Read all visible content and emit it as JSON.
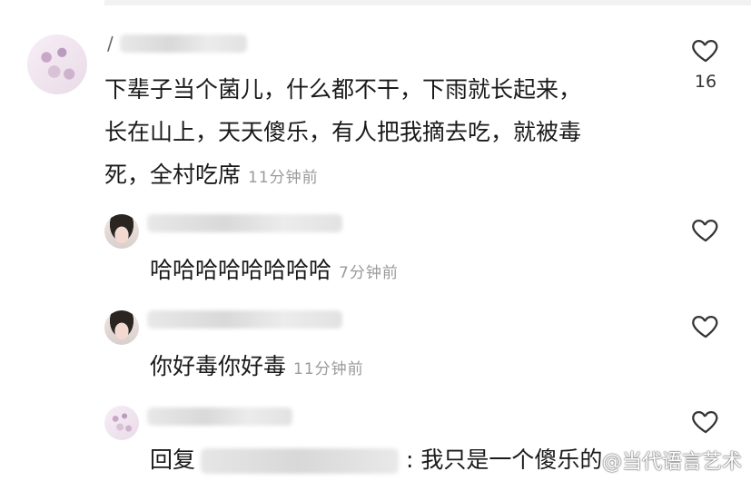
{
  "comments": [
    {
      "name_initial": "/",
      "lines": [
        "下辈子当个菌儿，什么都不干，下雨就长起来，",
        "长在山上，天天傻乐，有人把我摘去吃，就被毒",
        "死，全村吃席"
      ],
      "time": "11分钟前",
      "likes": "16"
    },
    {
      "text": "哈哈哈哈哈哈哈哈",
      "time": "7分钟前"
    },
    {
      "text": "你好毒你好毒",
      "time": "11分钟前"
    },
    {
      "reply_prefix": "回复",
      "reply_suffix": ": 我只是一个傻乐的"
    }
  ],
  "watermark": "@当代语言艺术",
  "icons": {
    "like": "heart-outline-icon"
  },
  "colors": {
    "text": "#1a1a1a",
    "time": "#9a9a9a",
    "icon": "#333333"
  }
}
